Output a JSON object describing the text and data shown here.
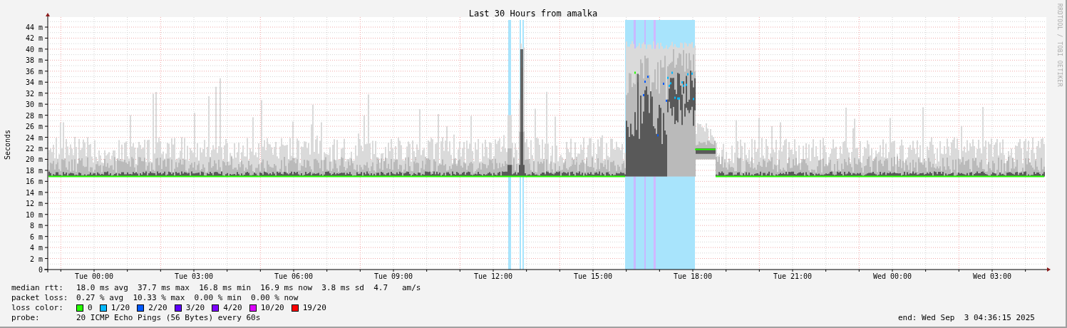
{
  "graph": {
    "title": "Last 30 Hours from amalka",
    "y_axis_label": "Seconds",
    "credit": "RRDTOOL / TOBI OETIKER",
    "y_ticks": [
      "44 m",
      "42 m",
      "40 m",
      "38 m",
      "36 m",
      "34 m",
      "32 m",
      "30 m",
      "28 m",
      "26 m",
      "24 m",
      "22 m",
      "20 m",
      "18 m",
      "16 m",
      "14 m",
      "12 m",
      "10 m",
      "8 m",
      "6 m",
      "4 m",
      "2 m",
      "0"
    ],
    "x_ticks": [
      "Tue 00:00",
      "Tue 03:00",
      "Tue 06:00",
      "Tue 09:00",
      "Tue 12:00",
      "Tue 15:00",
      "Tue 18:00",
      "Tue 21:00",
      "Wed 00:00",
      "Wed 03:00"
    ]
  },
  "legend": {
    "median_rtt": {
      "label": "median rtt:",
      "values": "18.0 ms avg  37.7 ms max  16.8 ms min  16.9 ms now  3.8 ms sd  4.7   am/s"
    },
    "packet_loss": {
      "label": "packet loss:",
      "values": "0.27 % avg  10.33 % max  0.00 % min  0.00 % now"
    },
    "loss_color": {
      "label": "loss color:",
      "items": [
        {
          "label": "0",
          "color": "#26ff00"
        },
        {
          "label": "1/20",
          "color": "#00b8ff"
        },
        {
          "label": "2/20",
          "color": "#0059ff"
        },
        {
          "label": "3/20",
          "color": "#5e00ff"
        },
        {
          "label": "4/20",
          "color": "#7e00ff"
        },
        {
          "label": "10/20",
          "color": "#dd00ff"
        },
        {
          "label": "19/20",
          "color": "#ff0000"
        }
      ]
    },
    "probe": {
      "label": "probe:",
      "value": "20 ICMP Echo Pings (56 Bytes) every 60s"
    },
    "end": "end: Wed Sep  3 04:36:15 2025"
  }
}
